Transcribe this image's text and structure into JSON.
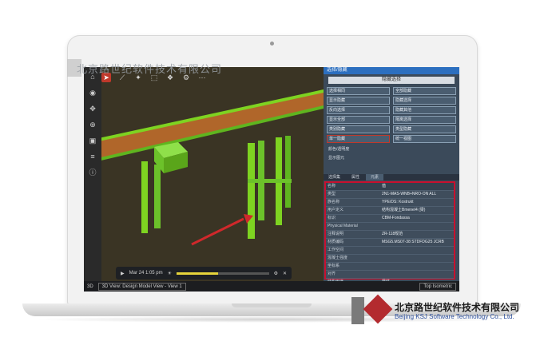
{
  "watermark": {
    "top_text": "北京路世纪软件技术有限公司",
    "company_cn": "北京路世纪软件技术有限公司",
    "company_en": "Beijing KSJ Software Technology Co., Ltd."
  },
  "viewport": {
    "toolbar_icons": [
      "home-icon",
      "select-icon",
      "measure-icon",
      "walk-icon",
      "section-icon",
      "settings-icon",
      "more-icon"
    ],
    "left_rail_icons": [
      "home-icon",
      "orbit-icon",
      "pan-icon",
      "zoom-icon",
      "fit-icon",
      "layers-icon",
      "properties-icon"
    ],
    "playbar": {
      "date": "Mar 24 1:05 pm",
      "progress": 0.45
    },
    "bottom": {
      "left_label": "3D",
      "view_select": "3D View: Design Model View - View 1",
      "right_select": "Top Isometric"
    }
  },
  "panel": {
    "header": "选择/隐藏",
    "dropdown": "隐藏选择",
    "buttons": [
      {
        "label": "选择相同",
        "highlight": false
      },
      {
        "label": "全部隐藏",
        "highlight": false
      },
      {
        "label": "显示隐藏",
        "highlight": false
      },
      {
        "label": "隐藏选择",
        "highlight": false
      },
      {
        "label": "反向选择",
        "highlight": false
      },
      {
        "label": "隐藏其他",
        "highlight": false
      },
      {
        "label": "显示全部",
        "highlight": false
      },
      {
        "label": "隔离选择",
        "highlight": false
      },
      {
        "label": "类别隐藏",
        "highlight": false
      },
      {
        "label": "类型隐藏",
        "highlight": false
      },
      {
        "label": "单一隐藏",
        "highlight": true
      },
      {
        "label": "统一视图",
        "highlight": false
      }
    ],
    "row1": "颜色/透明度",
    "row2": "显示图元",
    "tabs": [
      "选择集",
      "属性",
      "元素"
    ],
    "properties": {
      "header": [
        "名称",
        "值"
      ],
      "rows": [
        {
          "k": "类型",
          "v": "2N1-MAS-WNB+NRO-ON ALL"
        },
        {
          "k": "族名称",
          "v": "YPE/DS: Kostrukt"
        },
        {
          "k": "用户定义",
          "v": "结构混凝土Bmenel4 (梁)"
        },
        {
          "k": "标识",
          "v": "CBM-Fondassa"
        },
        {
          "k": "Physical Material",
          "v": ""
        },
        {
          "k": "注释说明",
          "v": "ZR-118规范"
        },
        {
          "k": "材质编码",
          "v": "MSG5.MS07-38 STDFDG25 JCRB"
        },
        {
          "k": "工作空间",
          "v": ""
        },
        {
          "k": "混凝土强度",
          "v": ""
        },
        {
          "k": "坐标系",
          "v": ""
        },
        {
          "k": "对齐",
          "v": ""
        },
        {
          "k": "结构用途",
          "v": "梁柱"
        }
      ]
    }
  }
}
